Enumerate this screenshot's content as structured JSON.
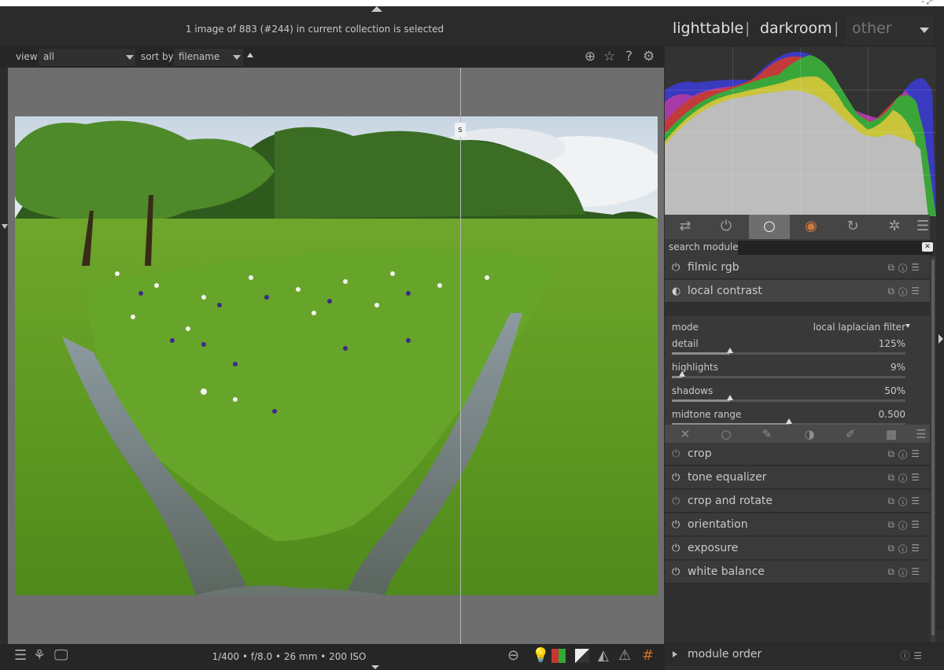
{
  "header": {
    "collection_message": "1 image of 883 (#244) in current collection is selected"
  },
  "filter": {
    "view_label": "view",
    "view_value": "all",
    "sort_label": "sort by",
    "sort_value": "filename"
  },
  "image": {
    "split_marker": "s"
  },
  "bottom": {
    "exif": "1/400 • f/8.0 • 26 mm • 200 ISO"
  },
  "views": {
    "lighttable": "lighttable",
    "separator": "|",
    "darkroom": "darkroom",
    "other": "other"
  },
  "search": {
    "label": "search module",
    "value": ""
  },
  "modules_top": [
    {
      "name": "filmic rgb",
      "enabled": true
    },
    {
      "name": "local contrast",
      "enabled": true
    }
  ],
  "local_contrast": {
    "mode_label": "mode",
    "mode_value": "local laplacian filter",
    "params": [
      {
        "label": "detail",
        "value": "125%",
        "level": 0.25
      },
      {
        "label": "highlights",
        "value": "9%",
        "level": 0.045
      },
      {
        "label": "shadows",
        "value": "50%",
        "level": 0.25
      },
      {
        "label": "midtone range",
        "value": "0.500",
        "level": 0.5
      }
    ]
  },
  "modules_bottom": [
    {
      "name": "crop",
      "enabled": false
    },
    {
      "name": "tone equalizer",
      "enabled": true
    },
    {
      "name": "crop and rotate",
      "enabled": false
    },
    {
      "name": "orientation",
      "enabled": true
    },
    {
      "name": "exposure",
      "enabled": true
    },
    {
      "name": "white balance",
      "enabled": true
    }
  ],
  "module_order": {
    "label": "module order"
  },
  "colors": {
    "background": "#2b2b2b",
    "panel": "#303030",
    "canvas": "#6e6e6e",
    "histogram_red": "#c33a3a",
    "histogram_green": "#3aa63a",
    "histogram_blue": "#3a3ac0"
  }
}
